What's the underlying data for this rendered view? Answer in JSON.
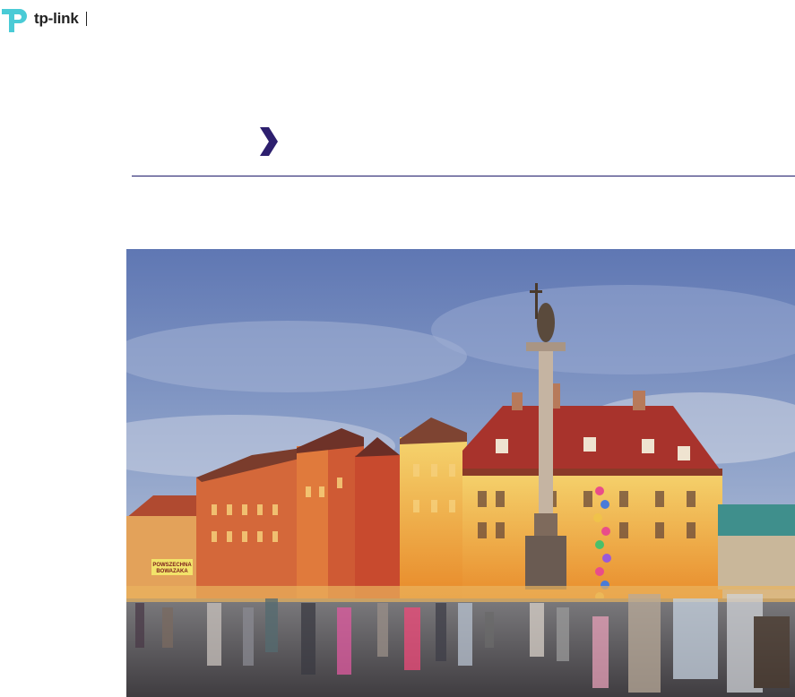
{
  "brand": {
    "logo_text": "tp-link",
    "logo_color": "#4acbd6",
    "icon": "tp-link-logo-icon"
  },
  "section": {
    "marker_icon": "chevron-right-icon",
    "marker_color": "#2d1f6e",
    "divider_color": "#1e1a6a"
  },
  "photo": {
    "subject": "city-square-photo",
    "sign_text": "POWSZECHNA BOWAZAKA"
  }
}
